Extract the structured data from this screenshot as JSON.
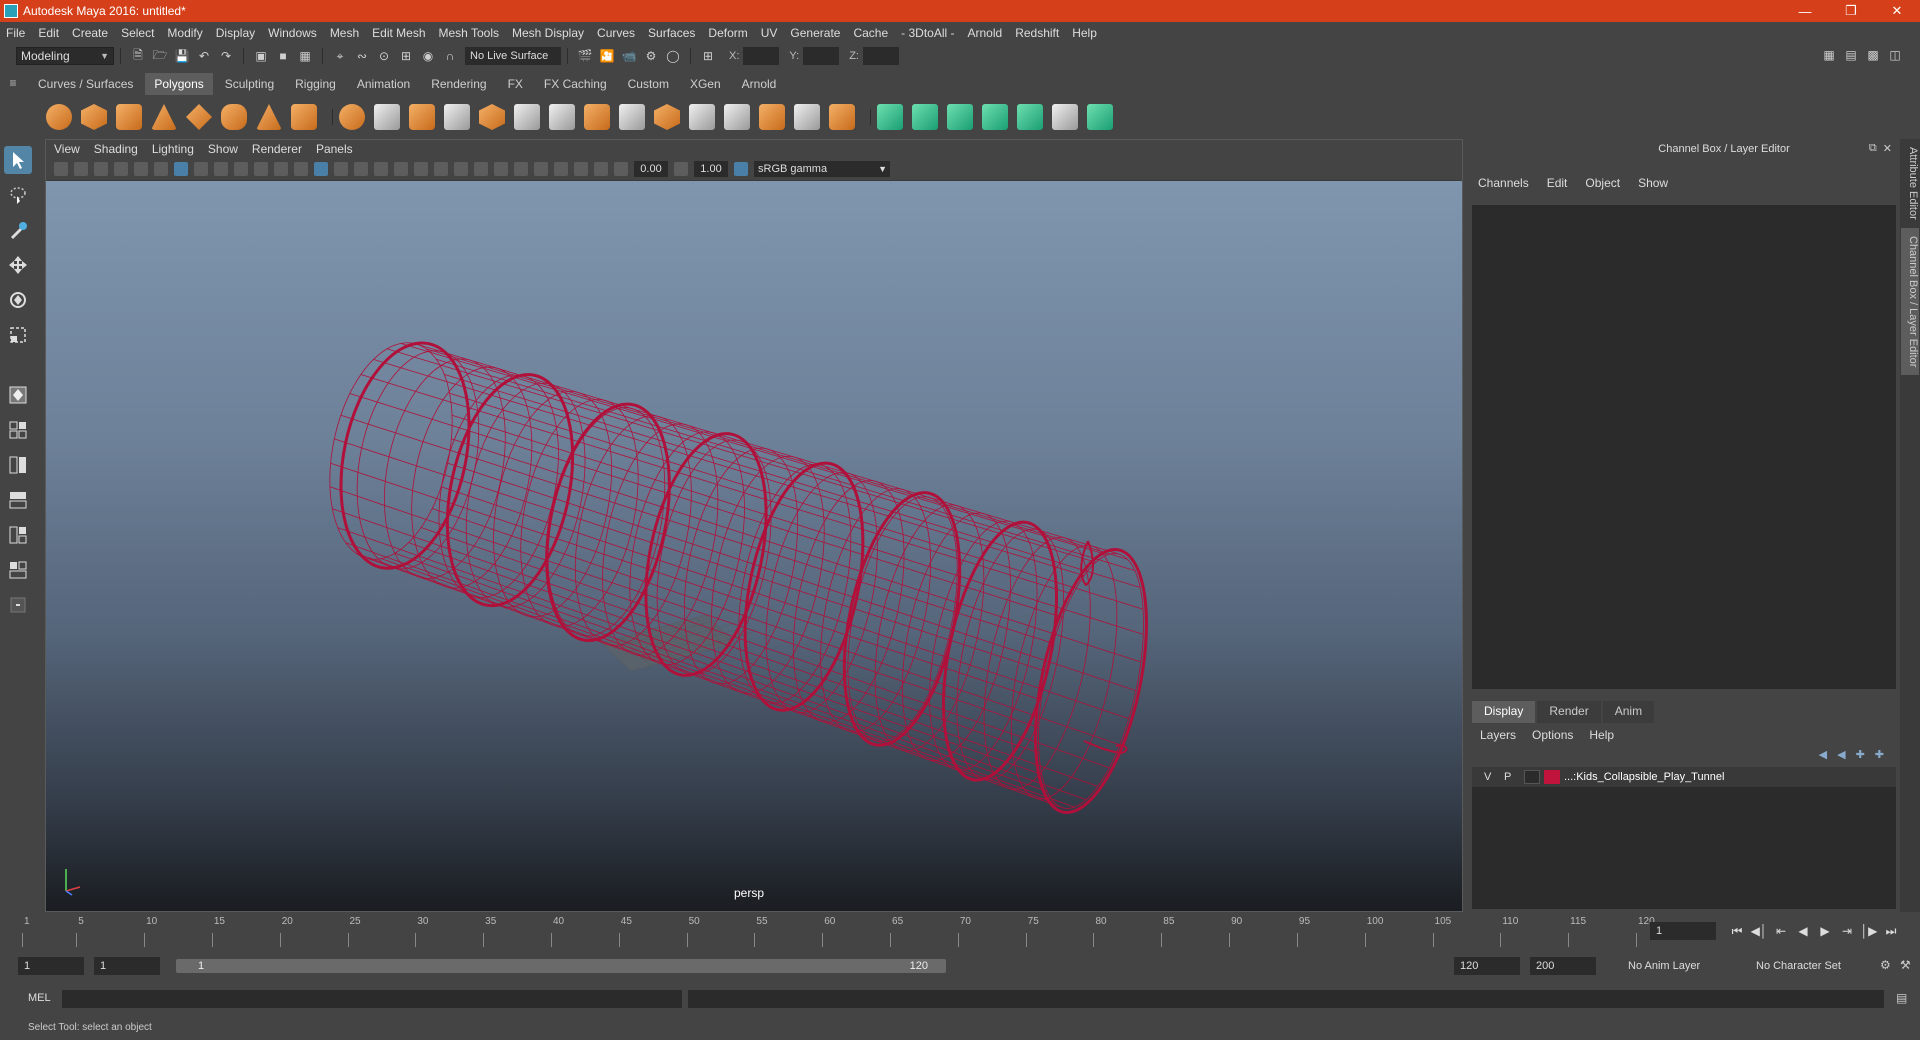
{
  "window": {
    "title": "Autodesk Maya 2016: untitled*"
  },
  "menubar": [
    "File",
    "Edit",
    "Create",
    "Select",
    "Modify",
    "Display",
    "Windows",
    "Mesh",
    "Edit Mesh",
    "Mesh Tools",
    "Mesh Display",
    "Curves",
    "Surfaces",
    "Deform",
    "UV",
    "Generate",
    "Cache",
    "- 3DtoAll -",
    "Arnold",
    "Redshift",
    "Help"
  ],
  "statusline": {
    "mode": "Modeling",
    "live_surface": "No Live Surface",
    "x_label": "X:",
    "y_label": "Y:",
    "z_label": "Z:"
  },
  "shelf_tabs": [
    "Curves / Surfaces",
    "Polygons",
    "Sculpting",
    "Rigging",
    "Animation",
    "Rendering",
    "FX",
    "FX Caching",
    "Custom",
    "XGen",
    "Arnold"
  ],
  "shelf_active": "Polygons",
  "viewport": {
    "menu": [
      "View",
      "Shading",
      "Lighting",
      "Show",
      "Renderer",
      "Panels"
    ],
    "exposure": "0.00",
    "gamma_value": "1.00",
    "color_space": "sRGB gamma",
    "camera_label": "persp",
    "wire_color": "#b0103a"
  },
  "channel_box": {
    "title": "Channel Box / Layer Editor",
    "menu": [
      "Channels",
      "Edit",
      "Object",
      "Show"
    ]
  },
  "layer_editor": {
    "tabs": [
      "Display",
      "Render",
      "Anim"
    ],
    "active_tab": "Display",
    "menu": [
      "Layers",
      "Options",
      "Help"
    ],
    "layers": [
      {
        "v": "V",
        "p": "P",
        "name": "...:Kids_Collapsible_Play_Tunnel",
        "color": "#c0143c"
      }
    ]
  },
  "side_tabs": [
    "Attribute Editor",
    "Channel Box / Layer Editor"
  ],
  "time_slider": {
    "ticks": [
      1,
      5,
      10,
      15,
      20,
      25,
      30,
      35,
      40,
      45,
      50,
      55,
      60,
      65,
      70,
      75,
      80,
      85,
      90,
      95,
      100,
      105,
      110,
      115,
      120
    ],
    "current_frame": "1"
  },
  "range": {
    "start": "1",
    "playback_start": "1",
    "slider_left": "1",
    "slider_right": "120",
    "playback_end": "120",
    "end": "200",
    "anim_layer": "No Anim Layer",
    "character_set": "No Character Set"
  },
  "command_line": {
    "label": "MEL"
  },
  "help_line": "Select Tool: select an object"
}
